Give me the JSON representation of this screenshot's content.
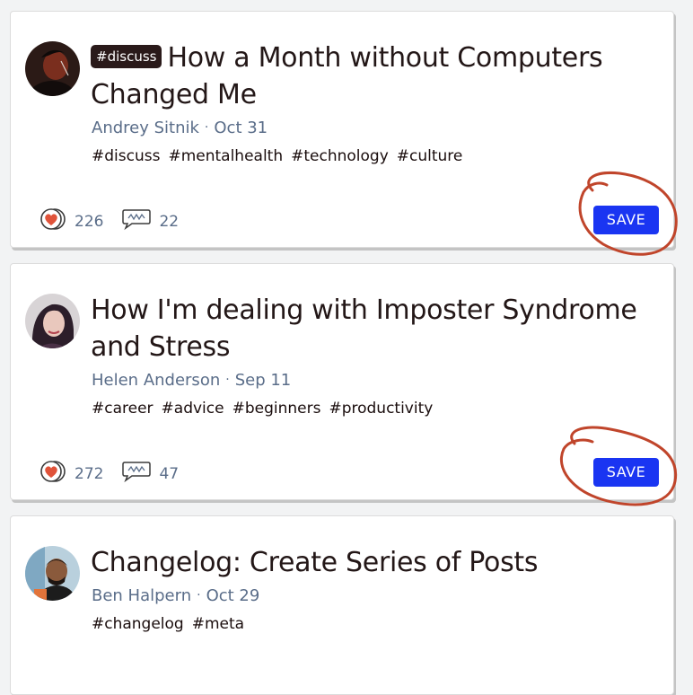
{
  "posts": [
    {
      "badge": "#discuss",
      "title": "How a Month without Computers Changed Me",
      "author": "Andrey Sitnik",
      "separator": "·",
      "date": "Oct 31",
      "tags": [
        "#discuss",
        "#mentalhealth",
        "#technology",
        "#culture"
      ],
      "reactions": "226",
      "comments": "22",
      "save_label": "SAVE",
      "avatar_icon": "avatar-andrey-sitnik"
    },
    {
      "badge": "",
      "title": "How I'm dealing with Imposter Syndrome and Stress",
      "author": "Helen Anderson",
      "separator": "·",
      "date": "Sep 11",
      "tags": [
        "#career",
        "#advice",
        "#beginners",
        "#productivity"
      ],
      "reactions": "272",
      "comments": "47",
      "save_label": "SAVE",
      "avatar_icon": "avatar-helen-anderson"
    },
    {
      "badge": "",
      "title": "Changelog: Create Series of Posts",
      "author": "Ben Halpern",
      "separator": "·",
      "date": "Oct 29",
      "tags": [
        "#changelog",
        "#meta"
      ],
      "avatar_icon": "avatar-ben-halpern"
    }
  ],
  "colors": {
    "save_button": "#1a35f2",
    "annotation": "#c0452b",
    "meta_text": "#5a6d89",
    "heart": "#e0533a"
  },
  "icons": {
    "reactions": "heart-icon",
    "comments": "comment-bubble-icon"
  }
}
